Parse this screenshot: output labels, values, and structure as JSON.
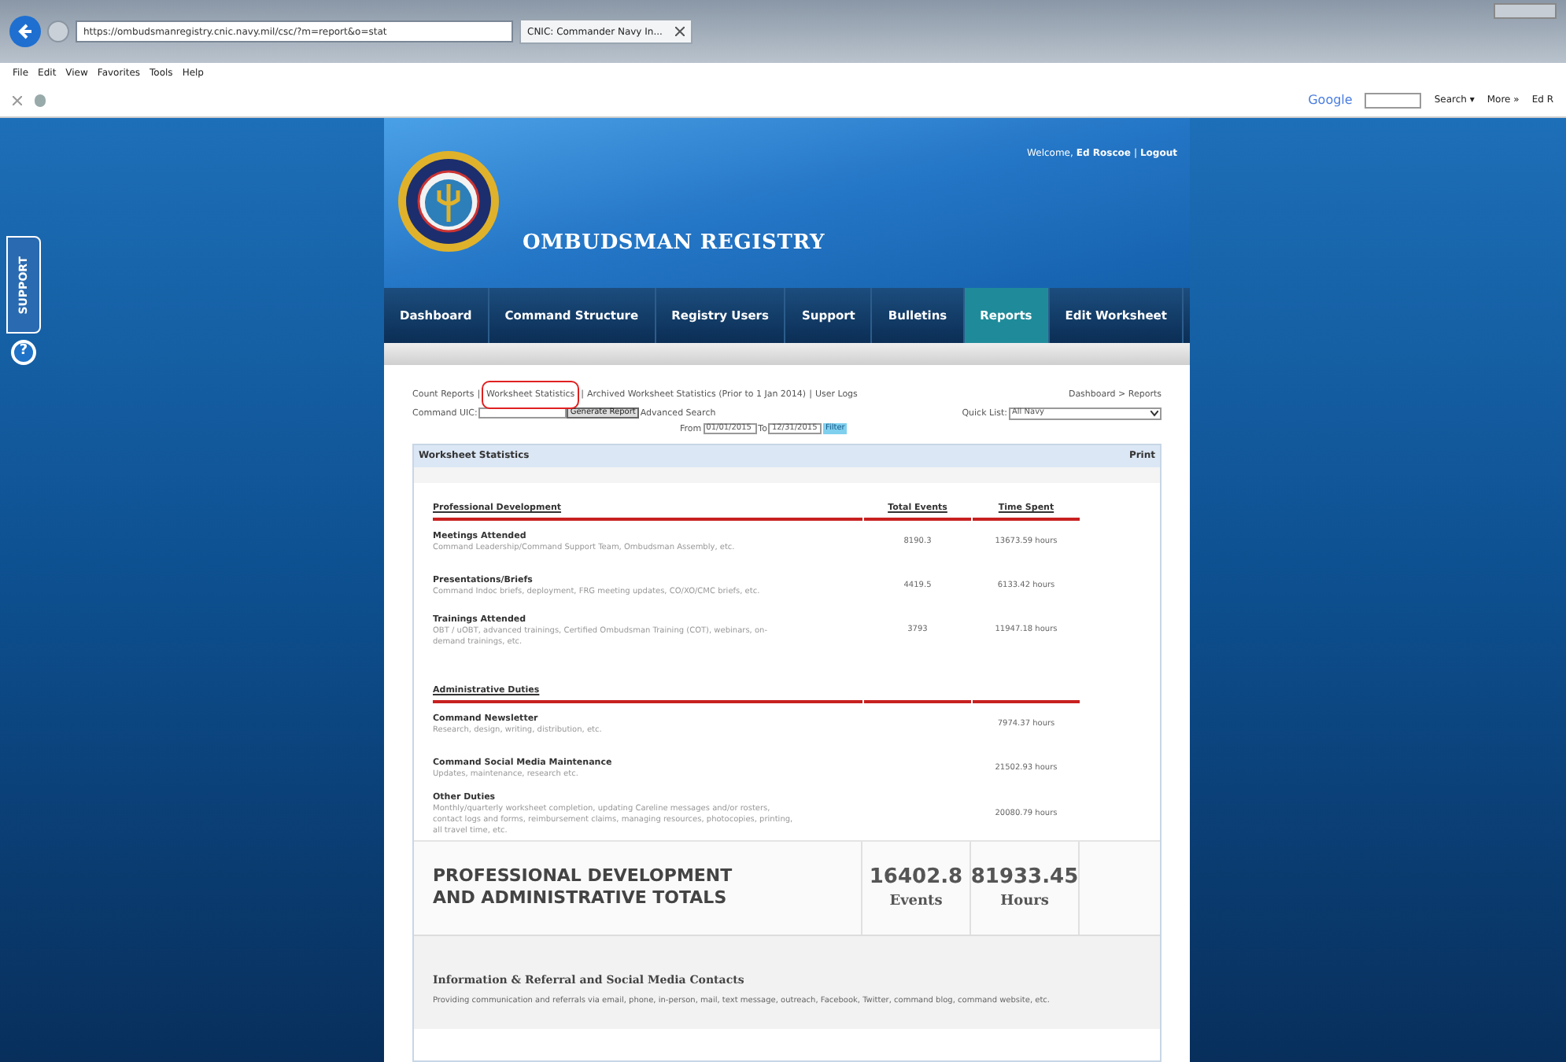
{
  "browser": {
    "url": "https://ombudsmanregistry.cnic.navy.mil/csc/?m=report&o=stat",
    "tab_title": "CNIC: Commander Navy In...",
    "menu": [
      "File",
      "Edit",
      "View",
      "Favorites",
      "Tools",
      "Help"
    ],
    "toolbar_search_label": "Google",
    "toolbar_buttons": [
      "Search ▾",
      "More »",
      "Ed R"
    ]
  },
  "support_tab": {
    "label": "SUPPORT",
    "help": "?"
  },
  "header": {
    "title": "OMBUDSMAN REGISTRY",
    "welcome": "Welcome,",
    "user": "Ed Roscoe",
    "separator": "|",
    "logout": "Logout"
  },
  "nav": [
    {
      "label": "Dashboard",
      "selected": false
    },
    {
      "label": "Command Structure",
      "selected": false
    },
    {
      "label": "Registry Users",
      "selected": false
    },
    {
      "label": "Support",
      "selected": false
    },
    {
      "label": "Bulletins",
      "selected": false
    },
    {
      "label": "Reports",
      "selected": true
    },
    {
      "label": "Edit Worksheet",
      "selected": false
    }
  ],
  "report_links": [
    {
      "label": "Count Reports",
      "highlighted": false
    },
    {
      "label": "Worksheet Statistics",
      "highlighted": true
    },
    {
      "label": "Archived Worksheet Statistics (Prior to 1 Jan 2014)",
      "highlighted": false
    },
    {
      "label": "User Logs",
      "highlighted": false
    }
  ],
  "report_link_separator": "|",
  "breadcrumb": "Dashboard > Reports",
  "filters": {
    "uic_label": "Command UIC:",
    "generate": "Generate Report",
    "advanced": "Advanced Search",
    "quick_list_label": "Quick List:",
    "quick_list_value": "All Navy",
    "from_label": "From",
    "from_value": "01/01/2015",
    "to_label": "To",
    "to_value": "12/31/2015",
    "filter": "Filter"
  },
  "panel": {
    "title": "Worksheet Statistics",
    "print": "Print"
  },
  "sections": [
    {
      "title": "Professional Development",
      "columns": [
        "Total Events",
        "Time Spent"
      ],
      "items": [
        {
          "title": "Meetings Attended",
          "description": "Command Leadership/Command Support Team, Ombudsman Assembly, etc.",
          "events": "8190.3",
          "time": "13673.59 hours"
        },
        {
          "title": "Presentations/Briefs",
          "description": "Command Indoc briefs, deployment, FRG meeting updates, CO/XO/CMC briefs, etc.",
          "events": "4419.5",
          "time": "6133.42 hours"
        },
        {
          "title": "Trainings Attended",
          "description": "OBT / uOBT, advanced trainings, Certified Ombudsman Training (COT), webinars, on-demand trainings, etc.",
          "events": "3793",
          "time": "11947.18 hours"
        }
      ]
    },
    {
      "title": "Administrative Duties",
      "items": [
        {
          "title": "Command Newsletter",
          "description": "Research, design, writing, distribution, etc.",
          "time": "7974.37 hours"
        },
        {
          "title": "Command Social Media Maintenance",
          "description": "Updates, maintenance, research etc.",
          "time": "21502.93 hours"
        },
        {
          "title": "Other Duties",
          "description": "Monthly/quarterly worksheet completion, updating Careline messages and/or rosters, contact logs and forms, reimbursement claims, managing resources, photocopies, printing, all travel time, etc.",
          "time": "20080.79 hours"
        }
      ]
    }
  ],
  "totals": {
    "label": "PROFESSIONAL DEVELOPMENT AND ADMINISTRATIVE TOTALS",
    "events": "16402.8",
    "events_unit": "Events",
    "hours": "81933.45",
    "hours_unit": "Hours"
  },
  "info_section": {
    "title": "Information & Referral and Social Media Contacts",
    "description": "Providing communication and referrals via email, phone, in-person, mail, text message, outreach, Facebook, Twitter, command blog, command website, etc."
  }
}
